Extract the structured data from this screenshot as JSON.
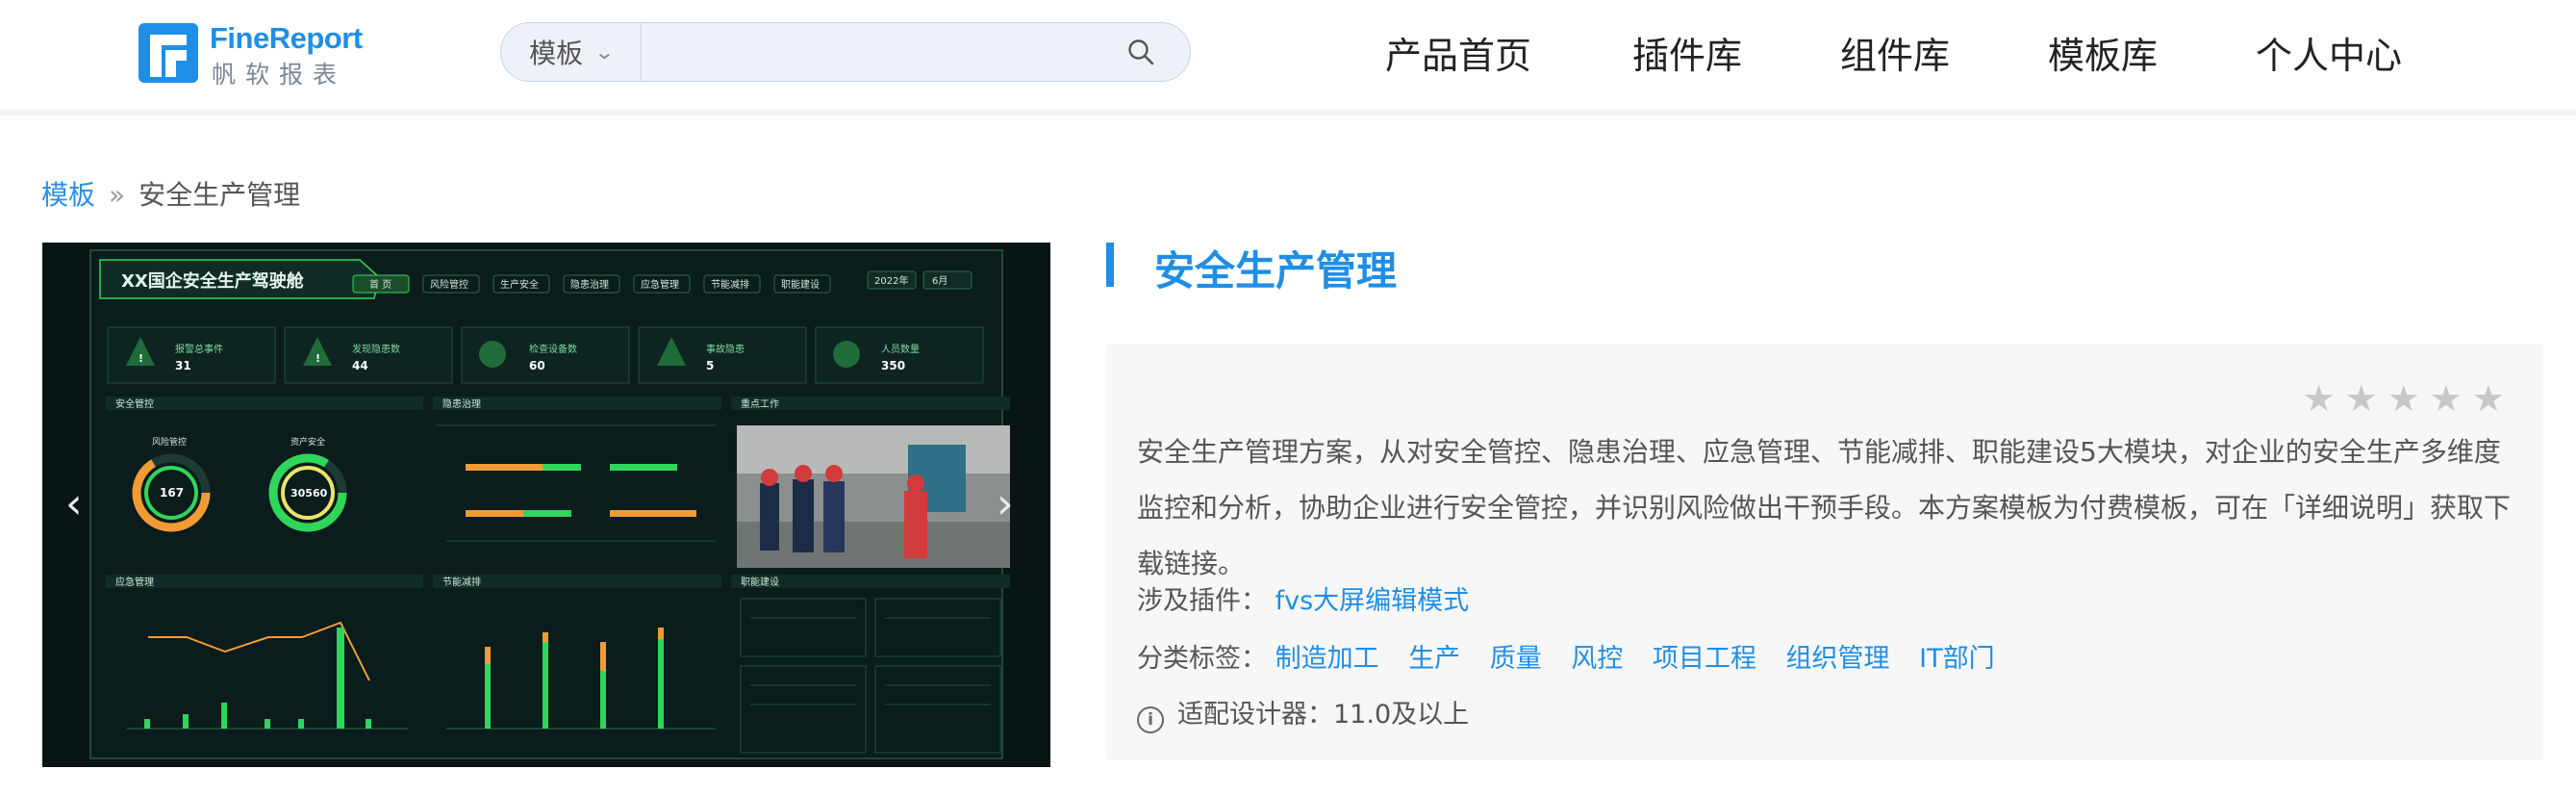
{
  "logo": {
    "en": "FineReport",
    "cn": "帆软报表"
  },
  "search": {
    "category": "模板",
    "placeholder": ""
  },
  "nav": [
    "产品首页",
    "插件库",
    "组件库",
    "模板库",
    "个人中心"
  ],
  "breadcrumb": {
    "parent": "模板",
    "separator": "»",
    "current": "安全生产管理"
  },
  "preview": {
    "dashboard_title": "XX国企安全生产驾驶舱",
    "tabs": [
      "首 页",
      "风险管控",
      "生产安全",
      "隐患治理",
      "应急管理",
      "节能减排",
      "职能建设"
    ],
    "year": "2022年",
    "month": "6月",
    "kpis": [
      {
        "label": "报警总事件",
        "value": "31"
      },
      {
        "label": "发现隐患数",
        "value": "44"
      },
      {
        "label": "检查设备数",
        "value": "60"
      },
      {
        "label": "事故隐患",
        "value": "5"
      },
      {
        "label": "人员数量",
        "value": "350"
      }
    ],
    "sections": [
      "安全管控",
      "隐患治理",
      "重点工作",
      "应急管理",
      "节能减排",
      "职能建设"
    ],
    "donuts": [
      {
        "label": "风险管控",
        "value": "167"
      },
      {
        "label": "资产安全",
        "value": "30560"
      }
    ]
  },
  "detail": {
    "title": "安全生产管理",
    "rating": 0,
    "description": "安全生产管理方案，从对安全管控、隐患治理、应急管理、节能减排、职能建设5大模块，对企业的安全生产多维度监控和分析，协助企业进行安全管控，并识别风险做出干预手段。本方案模板为付费模板，可在「详细说明」获取下载链接。",
    "plugin_label": "涉及插件：",
    "plugin": "fvs大屏编辑模式",
    "tags_label": "分类标签：",
    "tags": [
      "制造加工",
      "生产",
      "质量",
      "风控",
      "项目工程",
      "组织管理",
      "IT部门"
    ],
    "designer": "适配设计器：11.0及以上"
  },
  "colors": {
    "accent": "#1f8ee6",
    "dashboard_bg": "#0b1a1b",
    "dashboard_green": "#2fd65b",
    "dashboard_orange": "#f29b35"
  }
}
